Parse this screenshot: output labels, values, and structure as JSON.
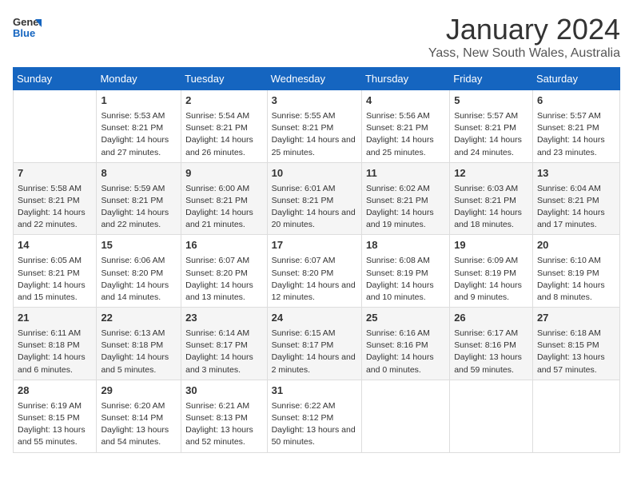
{
  "logo": {
    "line1": "General",
    "line2": "Blue"
  },
  "title": "January 2024",
  "subtitle": "Yass, New South Wales, Australia",
  "headers": [
    "Sunday",
    "Monday",
    "Tuesday",
    "Wednesday",
    "Thursday",
    "Friday",
    "Saturday"
  ],
  "weeks": [
    [
      {
        "day": "",
        "sunrise": "",
        "sunset": "",
        "daylight": ""
      },
      {
        "day": "1",
        "sunrise": "Sunrise: 5:53 AM",
        "sunset": "Sunset: 8:21 PM",
        "daylight": "Daylight: 14 hours and 27 minutes."
      },
      {
        "day": "2",
        "sunrise": "Sunrise: 5:54 AM",
        "sunset": "Sunset: 8:21 PM",
        "daylight": "Daylight: 14 hours and 26 minutes."
      },
      {
        "day": "3",
        "sunrise": "Sunrise: 5:55 AM",
        "sunset": "Sunset: 8:21 PM",
        "daylight": "Daylight: 14 hours and 25 minutes."
      },
      {
        "day": "4",
        "sunrise": "Sunrise: 5:56 AM",
        "sunset": "Sunset: 8:21 PM",
        "daylight": "Daylight: 14 hours and 25 minutes."
      },
      {
        "day": "5",
        "sunrise": "Sunrise: 5:57 AM",
        "sunset": "Sunset: 8:21 PM",
        "daylight": "Daylight: 14 hours and 24 minutes."
      },
      {
        "day": "6",
        "sunrise": "Sunrise: 5:57 AM",
        "sunset": "Sunset: 8:21 PM",
        "daylight": "Daylight: 14 hours and 23 minutes."
      }
    ],
    [
      {
        "day": "7",
        "sunrise": "Sunrise: 5:58 AM",
        "sunset": "Sunset: 8:21 PM",
        "daylight": "Daylight: 14 hours and 22 minutes."
      },
      {
        "day": "8",
        "sunrise": "Sunrise: 5:59 AM",
        "sunset": "Sunset: 8:21 PM",
        "daylight": "Daylight: 14 hours and 22 minutes."
      },
      {
        "day": "9",
        "sunrise": "Sunrise: 6:00 AM",
        "sunset": "Sunset: 8:21 PM",
        "daylight": "Daylight: 14 hours and 21 minutes."
      },
      {
        "day": "10",
        "sunrise": "Sunrise: 6:01 AM",
        "sunset": "Sunset: 8:21 PM",
        "daylight": "Daylight: 14 hours and 20 minutes."
      },
      {
        "day": "11",
        "sunrise": "Sunrise: 6:02 AM",
        "sunset": "Sunset: 8:21 PM",
        "daylight": "Daylight: 14 hours and 19 minutes."
      },
      {
        "day": "12",
        "sunrise": "Sunrise: 6:03 AM",
        "sunset": "Sunset: 8:21 PM",
        "daylight": "Daylight: 14 hours and 18 minutes."
      },
      {
        "day": "13",
        "sunrise": "Sunrise: 6:04 AM",
        "sunset": "Sunset: 8:21 PM",
        "daylight": "Daylight: 14 hours and 17 minutes."
      }
    ],
    [
      {
        "day": "14",
        "sunrise": "Sunrise: 6:05 AM",
        "sunset": "Sunset: 8:21 PM",
        "daylight": "Daylight: 14 hours and 15 minutes."
      },
      {
        "day": "15",
        "sunrise": "Sunrise: 6:06 AM",
        "sunset": "Sunset: 8:20 PM",
        "daylight": "Daylight: 14 hours and 14 minutes."
      },
      {
        "day": "16",
        "sunrise": "Sunrise: 6:07 AM",
        "sunset": "Sunset: 8:20 PM",
        "daylight": "Daylight: 14 hours and 13 minutes."
      },
      {
        "day": "17",
        "sunrise": "Sunrise: 6:07 AM",
        "sunset": "Sunset: 8:20 PM",
        "daylight": "Daylight: 14 hours and 12 minutes."
      },
      {
        "day": "18",
        "sunrise": "Sunrise: 6:08 AM",
        "sunset": "Sunset: 8:19 PM",
        "daylight": "Daylight: 14 hours and 10 minutes."
      },
      {
        "day": "19",
        "sunrise": "Sunrise: 6:09 AM",
        "sunset": "Sunset: 8:19 PM",
        "daylight": "Daylight: 14 hours and 9 minutes."
      },
      {
        "day": "20",
        "sunrise": "Sunrise: 6:10 AM",
        "sunset": "Sunset: 8:19 PM",
        "daylight": "Daylight: 14 hours and 8 minutes."
      }
    ],
    [
      {
        "day": "21",
        "sunrise": "Sunrise: 6:11 AM",
        "sunset": "Sunset: 8:18 PM",
        "daylight": "Daylight: 14 hours and 6 minutes."
      },
      {
        "day": "22",
        "sunrise": "Sunrise: 6:13 AM",
        "sunset": "Sunset: 8:18 PM",
        "daylight": "Daylight: 14 hours and 5 minutes."
      },
      {
        "day": "23",
        "sunrise": "Sunrise: 6:14 AM",
        "sunset": "Sunset: 8:17 PM",
        "daylight": "Daylight: 14 hours and 3 minutes."
      },
      {
        "day": "24",
        "sunrise": "Sunrise: 6:15 AM",
        "sunset": "Sunset: 8:17 PM",
        "daylight": "Daylight: 14 hours and 2 minutes."
      },
      {
        "day": "25",
        "sunrise": "Sunrise: 6:16 AM",
        "sunset": "Sunset: 8:16 PM",
        "daylight": "Daylight: 14 hours and 0 minutes."
      },
      {
        "day": "26",
        "sunrise": "Sunrise: 6:17 AM",
        "sunset": "Sunset: 8:16 PM",
        "daylight": "Daylight: 13 hours and 59 minutes."
      },
      {
        "day": "27",
        "sunrise": "Sunrise: 6:18 AM",
        "sunset": "Sunset: 8:15 PM",
        "daylight": "Daylight: 13 hours and 57 minutes."
      }
    ],
    [
      {
        "day": "28",
        "sunrise": "Sunrise: 6:19 AM",
        "sunset": "Sunset: 8:15 PM",
        "daylight": "Daylight: 13 hours and 55 minutes."
      },
      {
        "day": "29",
        "sunrise": "Sunrise: 6:20 AM",
        "sunset": "Sunset: 8:14 PM",
        "daylight": "Daylight: 13 hours and 54 minutes."
      },
      {
        "day": "30",
        "sunrise": "Sunrise: 6:21 AM",
        "sunset": "Sunset: 8:13 PM",
        "daylight": "Daylight: 13 hours and 52 minutes."
      },
      {
        "day": "31",
        "sunrise": "Sunrise: 6:22 AM",
        "sunset": "Sunset: 8:12 PM",
        "daylight": "Daylight: 13 hours and 50 minutes."
      },
      {
        "day": "",
        "sunrise": "",
        "sunset": "",
        "daylight": ""
      },
      {
        "day": "",
        "sunrise": "",
        "sunset": "",
        "daylight": ""
      },
      {
        "day": "",
        "sunrise": "",
        "sunset": "",
        "daylight": ""
      }
    ]
  ]
}
